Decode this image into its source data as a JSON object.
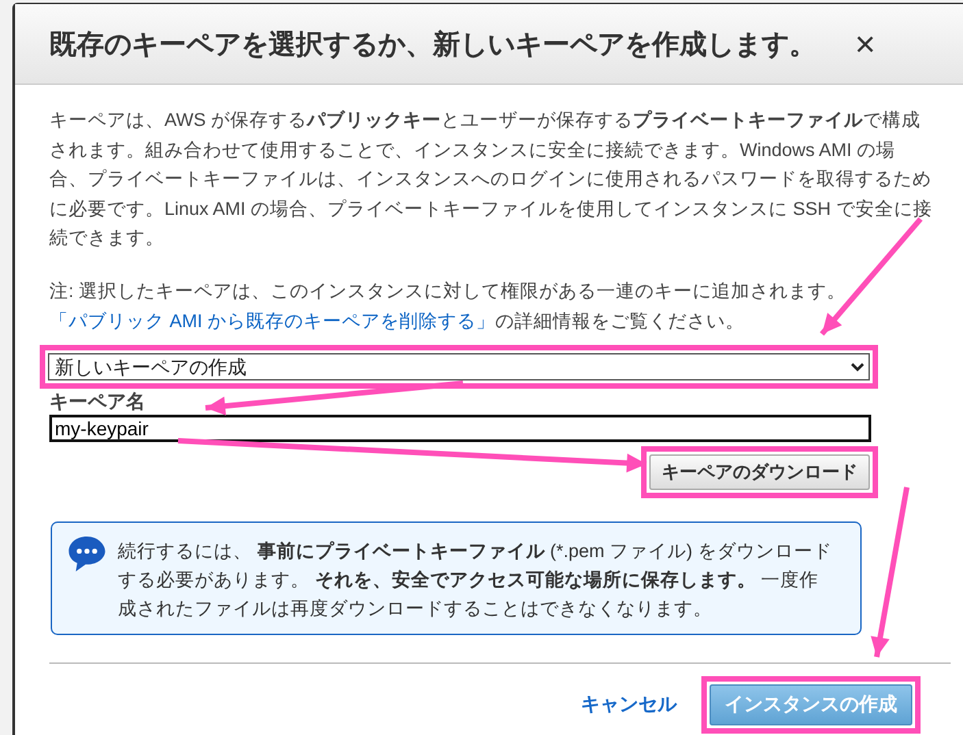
{
  "dialog": {
    "title": "既存のキーペアを選択するか、新しいキーペアを作成します。",
    "close": "×",
    "description": "キーペアは、AWS が保存する**パブリックキー**とユーザーが保存する**プライベートキーファイル**で構成されます。組み合わせて使用することで、インスタンスに安全に接続できます。Windows AMI の場合、プライベートキーファイルは、インスタンスへのログインに使用されるパスワードを取得するために必要です。Linux AMI の場合、プライベートキーファイルを使用してインスタンスに SSH で安全に接続できます。",
    "note": {
      "text": "注: 選択したキーペアは、このインスタンスに対して権限がある一連のキーに追加されます。",
      "link": "「パブリック AMI から既存のキーペアを削除する」",
      "suffix": "の詳細情報をご覧ください。"
    },
    "keypair_select": {
      "value": "新しいキーペアの作成"
    },
    "keypair_name": {
      "label": "キーペア名",
      "value": "my-keypair"
    },
    "download_button": "キーペアのダウンロード",
    "info": "続行するには、 **事前にプライベートキーファイル** (*.pem ファイル) をダウンロードする必要があります。 **それを、安全でアクセス可能な場所に保存します。** 一度作成されたファイルは再度ダウンロードすることはできなくなります。",
    "buttons": [
      {
        "kind": "link",
        "label": "キャンセル"
      },
      {
        "kind": "primary",
        "label": "インスタンスの作成"
      }
    ]
  }
}
